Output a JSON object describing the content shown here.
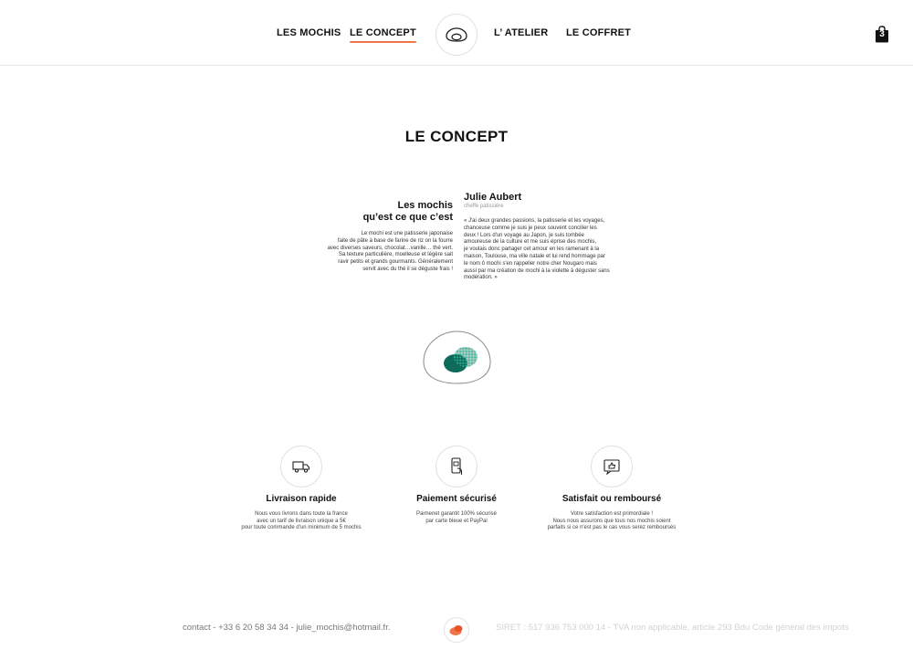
{
  "nav": {
    "items": [
      {
        "label": "LES MOCHIS"
      },
      {
        "label": "LE CONCEPT"
      },
      {
        "label": "L’ ATELIER"
      },
      {
        "label": "LE COFFRET"
      }
    ],
    "active_index": 1,
    "cart_count": "3",
    "accent_color": "#f0764a"
  },
  "page": {
    "title": "LE CONCEPT"
  },
  "concept": {
    "left": {
      "heading_line1": "Les mochis",
      "heading_line2": "qu’est ce que c’est",
      "body_lines": [
        "Le mochi est une patisserie japonaise",
        "faite de pâte à base de farine de riz on la fourre",
        "avec  diverses saveurs, chocolat…vanille… thé vert.",
        "Sa texture particulière, moelleuse et légère sait",
        "ravir petits et grands gourmants. Généralement",
        "servit avec du thé il se déguste frais !"
      ]
    },
    "right": {
      "name": "Julie Aubert",
      "role": "cheffe patissière",
      "quote_lines": [
        "« J'ai deux grandes passions, la patisserie et les voyages,",
        "chanceuse comme je suis je peux souvent concilier les",
        "deux ! Lors d'un voyage au Japon, je suis tombée",
        "amoureuse de la culture et me suis éprise des mochis,",
        "je voulais donc partager cet amour en les ramenant à la",
        "maison, Toulouse, ma ville natale et lui rend hommage par",
        "le nom ô mochi s'en rappeller notre cher Nougaro mais",
        "aussi par ma création de mochi à la violette à déguster sans",
        "modération. »"
      ]
    }
  },
  "illustration": {
    "mochi_color": "#0e6b5a",
    "mochi_dots_color": "#2fb594"
  },
  "features": [
    {
      "icon": "truck-icon",
      "title": "Livraison rapide",
      "lines": [
        "Nous vous livrons dans toute la france",
        "avec un tarif de livraison unique a 5€",
        "pour toute commande d'un minimum de 5 mochis"
      ]
    },
    {
      "icon": "phone-payment-icon",
      "title": "Paiement sécurisé",
      "lines": [
        "Paimenet garantit 100% sécurisé",
        "par carte bleue et PayPal"
      ]
    },
    {
      "icon": "thumbs-up-icon",
      "title": "Satisfait ou remboursé",
      "lines": [
        "Votre satisfaction est primordiale !",
        "Nous nous assurons que tous nos mochis soient",
        "parfaits si ce n'est pas le cas vous serez remboursés"
      ]
    }
  ],
  "footer": {
    "contact": "contact - +33 6 20 58 34 34 - julie_mochis@hotmail.fr.",
    "legal": "SIRET : 517 936 753 000 14 - TVA non applicable, article 293 Bdu Code général des impots",
    "logo_color": "#f0764a"
  }
}
